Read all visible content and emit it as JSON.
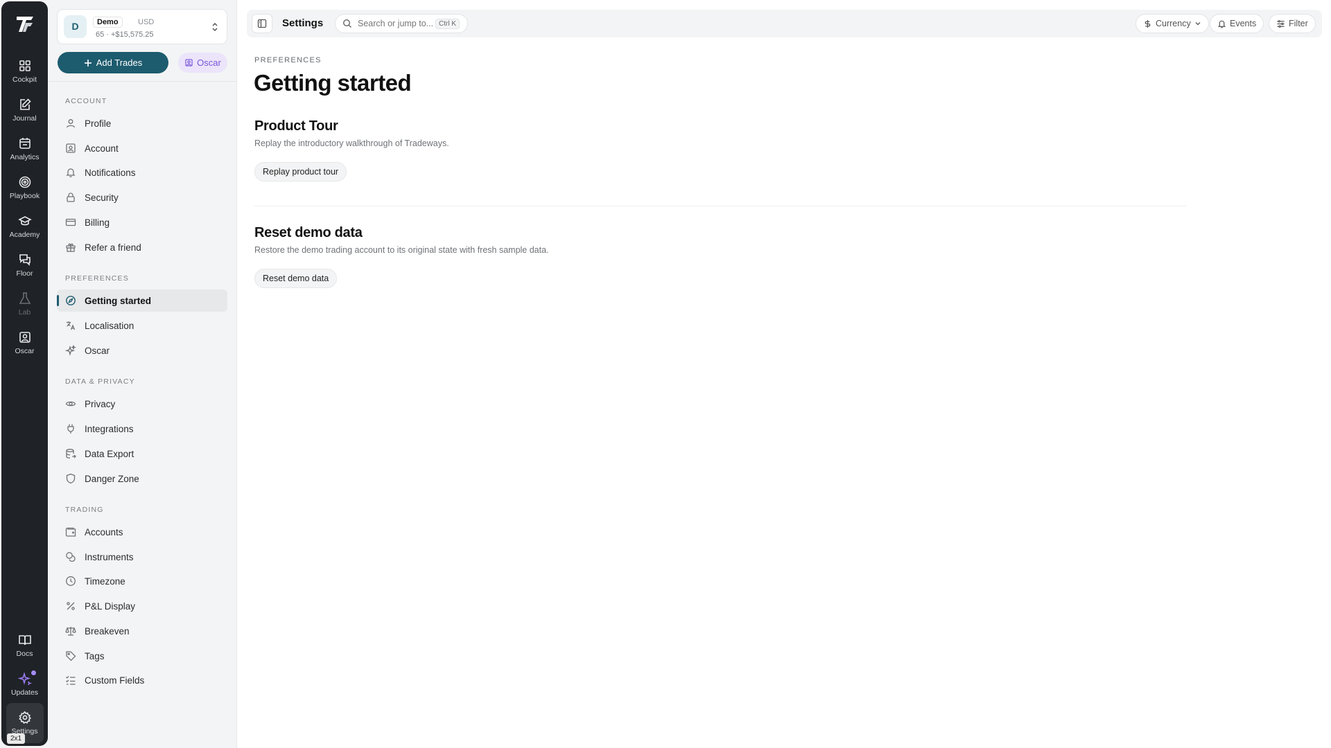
{
  "rail": {
    "items": [
      {
        "label": "Cockpit",
        "icon": "grid-icon"
      },
      {
        "label": "Journal",
        "icon": "edit-icon"
      },
      {
        "label": "Analytics",
        "icon": "calendar-icon"
      },
      {
        "label": "Playbook",
        "icon": "target-icon"
      },
      {
        "label": "Academy",
        "icon": "graduation-cap-icon"
      },
      {
        "label": "Floor",
        "icon": "chat-icon"
      },
      {
        "label": "Lab",
        "icon": "flask-icon"
      },
      {
        "label": "Oscar",
        "icon": "user-square-icon"
      }
    ],
    "bottom": [
      {
        "label": "Docs",
        "icon": "book-icon"
      },
      {
        "label": "Updates",
        "icon": "sparkles-icon"
      },
      {
        "label": "Settings",
        "icon": "gear-icon"
      }
    ],
    "badge": "2x1"
  },
  "account": {
    "avatar": "D",
    "name": "Demo",
    "currency": "USD",
    "stats": "65 · +$15,575.25"
  },
  "actions": {
    "add_trades": "Add Trades",
    "oscar": "Oscar"
  },
  "sidebar": {
    "sections": [
      {
        "label": "ACCOUNT",
        "items": [
          "Profile",
          "Account",
          "Notifications",
          "Security",
          "Billing",
          "Refer a friend"
        ]
      },
      {
        "label": "PREFERENCES",
        "items": [
          "Getting started",
          "Localisation",
          "Oscar"
        ]
      },
      {
        "label": "DATA & PRIVACY",
        "items": [
          "Privacy",
          "Integrations",
          "Data Export",
          "Danger Zone"
        ]
      },
      {
        "label": "TRADING",
        "items": [
          "Accounts",
          "Instruments",
          "Timezone",
          "P&L Display",
          "Breakeven",
          "Tags",
          "Custom Fields"
        ]
      }
    ],
    "active": "Getting started"
  },
  "topbar": {
    "title": "Settings",
    "search_placeholder": "Search or jump to...",
    "shortcut": "Ctrl K",
    "currency": "Currency",
    "events": "Events",
    "filter": "Filter"
  },
  "main": {
    "breadcrumb": "PREFERENCES",
    "title": "Getting started",
    "sections": [
      {
        "title": "Product Tour",
        "description": "Replay the introductory walkthrough of Tradeways.",
        "button": "Replay product tour"
      },
      {
        "title": "Reset demo data",
        "description": "Restore the demo trading account to its original state with fresh sample data.",
        "button": "Reset demo data"
      }
    ]
  },
  "colors": {
    "accent": "#1d5b6e",
    "rail_bg": "#1f2226",
    "oscar_purple": "#7a55d8"
  }
}
